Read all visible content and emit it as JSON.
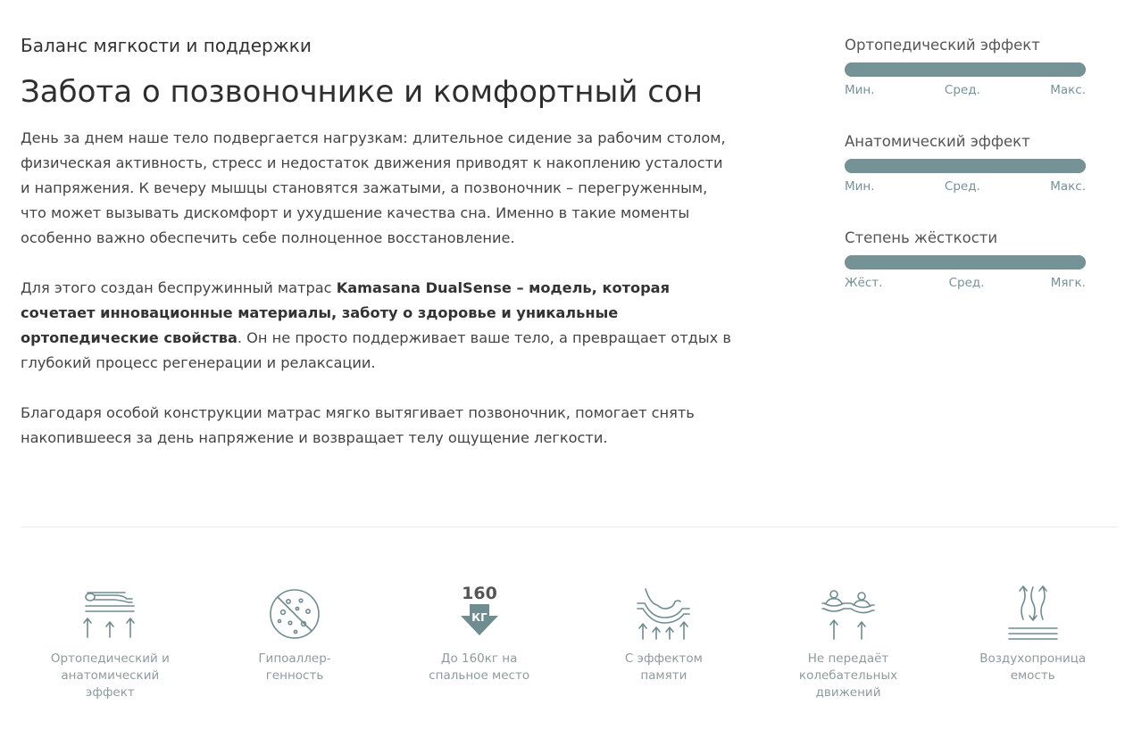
{
  "header": {
    "subtitle": "Баланс мягкости и поддержки",
    "title": "Забота о позвоночнике и комфортный сон"
  },
  "body": {
    "paragraph1": "День за днем наше тело подвергается нагрузкам: длительное сидение за рабочим столом, физическая активность, стресс и недостаток движения приводят к накоплению усталости и напряжения. К вечеру мышцы становятся зажатыми, а позвоночник – перегруженным, что может вызывать дискомфорт и ухудшение качества сна. Именно в такие моменты особенно важно обеспечить себе полноценное восстановление.",
    "paragraph2_before": "Для этого создан беспружинный матрас ",
    "paragraph2_bold": "Kamasana DualSense – модель, которая сочетает инновационные материалы, заботу о здоровье и уникальные ортопедические свойства",
    "paragraph2_after": ". Он не просто поддерживает ваше тело, а превращает отдых в глубокий процесс регенерации и релаксации.",
    "paragraph3": "Благодаря особой конструкции матрас мягко вытягивает позвоночник, помогает снять накопившееся за день напряжение и возвращает телу ощущение легкости."
  },
  "scales": [
    {
      "title": "Ортопедический эффект",
      "level": 1.0,
      "ticks": [
        "Мин.",
        "Сред.",
        "Макс."
      ]
    },
    {
      "title": "Анатомический эффект",
      "level": 1.0,
      "ticks": [
        "Мин.",
        "Сред.",
        "Макс."
      ]
    },
    {
      "title": "Степень жёсткости",
      "level": 1.0,
      "ticks": [
        "Жёст.",
        "Сред.",
        "Мягк."
      ]
    }
  ],
  "features": [
    {
      "icon": "orthopedic-icon",
      "label": "Ортопедический и\nанатомический\nэффект"
    },
    {
      "icon": "hypoallergenic-icon",
      "label": "Гипоаллер-\nгенность"
    },
    {
      "icon": "weight-160kg-icon",
      "label": "До 160кг на\nспальное место",
      "icon_number": "160",
      "icon_unit": "КГ"
    },
    {
      "icon": "memory-effect-icon",
      "label": "С эффектом\nпамяти"
    },
    {
      "icon": "no-motion-transfer-icon",
      "label": "Не передаёт\nколебательных\nдвижений"
    },
    {
      "icon": "breathability-icon",
      "label": "Воздухопроница\nемость"
    }
  ],
  "colors": {
    "accent": "#759297",
    "label_gray": "#8d9b9d",
    "text": "#444444"
  }
}
